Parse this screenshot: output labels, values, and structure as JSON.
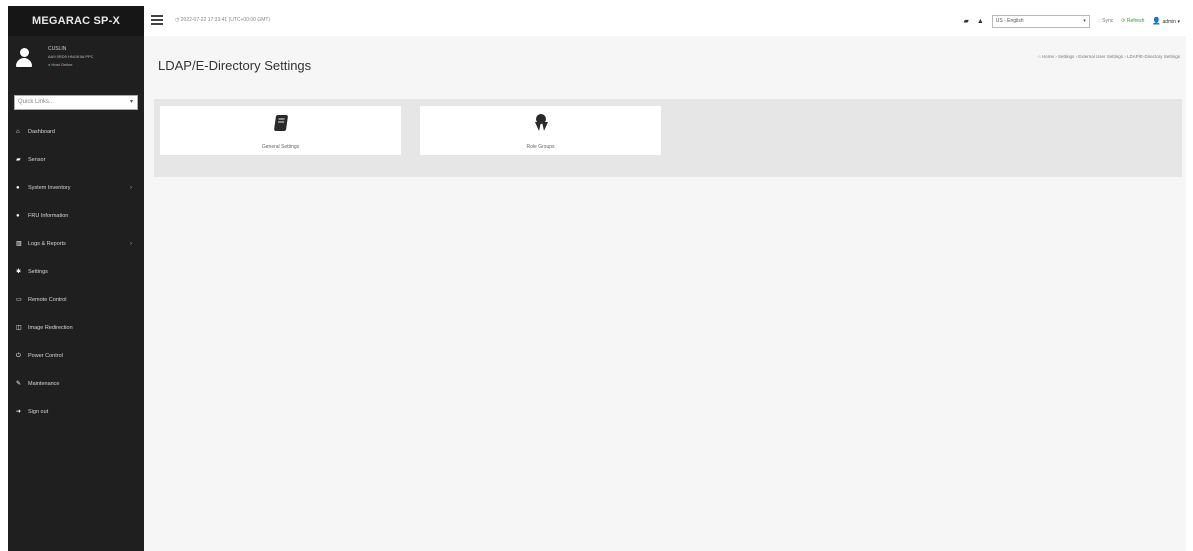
{
  "sidebar": {
    "brand": "MEGARAC SP-X",
    "user": {
      "name": "CUSLIN",
      "detail": "AA9 0RD9 HNIJK9A PPC",
      "status": "Host Online"
    },
    "quick_links_placeholder": "Quick Links...",
    "items": [
      {
        "label": "Dashboard",
        "icon": "home-icon",
        "glyph": "⌂",
        "has_children": false
      },
      {
        "label": "Sensor",
        "icon": "car-icon",
        "glyph": "▰",
        "has_children": false
      },
      {
        "label": "System Inventory",
        "icon": "circle-info-icon",
        "glyph": "●",
        "has_children": true
      },
      {
        "label": "FRU Information",
        "icon": "circle-info-icon",
        "glyph": "●",
        "has_children": false
      },
      {
        "label": "Logs & Reports",
        "icon": "bar-chart-icon",
        "glyph": "▥",
        "has_children": true
      },
      {
        "label": "Settings",
        "icon": "gear-icon",
        "glyph": "✱",
        "has_children": false
      },
      {
        "label": "Remote Control",
        "icon": "monitor-icon",
        "glyph": "▭",
        "has_children": false
      },
      {
        "label": "Image Redirection",
        "icon": "disk-icon",
        "glyph": "◫",
        "has_children": false
      },
      {
        "label": "Power Control",
        "icon": "power-icon",
        "glyph": "⏻",
        "has_children": false
      },
      {
        "label": "Maintenance",
        "icon": "wrench-icon",
        "glyph": "✎",
        "has_children": false
      },
      {
        "label": "Sign out",
        "icon": "sign-out-icon",
        "glyph": "➜",
        "has_children": false
      }
    ]
  },
  "header": {
    "datetime": "◷ 2022-07-22 17:33:41 (UTC+00:00 GMT)",
    "language": "US - English",
    "sync_label": "◌ Sync",
    "refresh_label": "⟳ Refresh",
    "user_label": "admin ▾"
  },
  "main": {
    "title": "LDAP/E-Directory Settings",
    "breadcrumb": "⌂ Home › Settings › External User Settings › LDAP/E-Directory Settings",
    "cards": [
      {
        "label": "General Settings",
        "icon": "book-icon"
      },
      {
        "label": "Role Groups",
        "icon": "award-icon"
      }
    ]
  },
  "colors": {
    "sidebar_bg": "#1f1f1f",
    "content_bg": "#f6f6f6",
    "panel_bg": "#e6e6e6",
    "refresh_green": "#2e9b2e",
    "status_green": "#4caf50"
  }
}
